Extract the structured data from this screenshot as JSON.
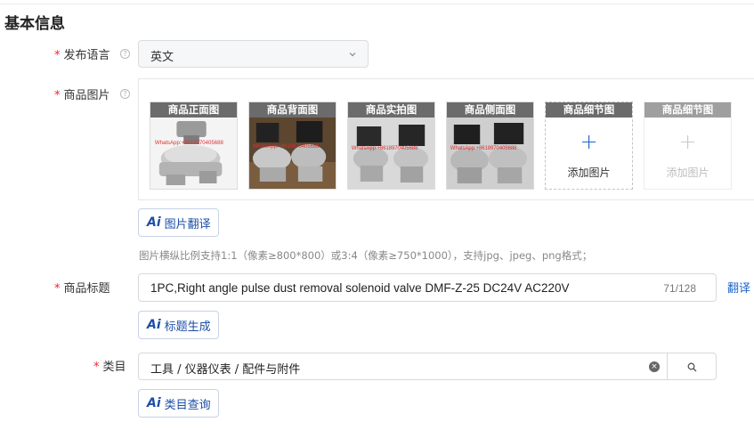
{
  "section": {
    "title": "基本信息"
  },
  "language": {
    "label": "发布语言",
    "required_mark": "*",
    "help": "?",
    "value": "英文"
  },
  "images": {
    "label": "商品图片",
    "required_mark": "*",
    "help": "?",
    "slots": [
      {
        "caption": "商品正面图",
        "watermark": "WhatsApp:+8618970405688"
      },
      {
        "caption": "商品背面图",
        "watermark": "WhatsApp:+8618970405688"
      },
      {
        "caption": "商品实拍图",
        "watermark": "WhatsApp:+8618970405688"
      },
      {
        "caption": "商品侧面图",
        "watermark": "WhatsApp:+8618970405688"
      }
    ],
    "add_slots": [
      {
        "caption": "商品细节图",
        "plus": "+",
        "add_label": "添加图片",
        "state": "enabled"
      },
      {
        "caption": "商品细节图",
        "plus": "+",
        "add_label": "添加图片",
        "state": "disabled"
      }
    ],
    "ai_translate": {
      "mark": "Ai",
      "label": "图片翻译"
    },
    "hint": "图片横纵比例支持1:1（像素≥800*800）或3:4（像素≥750*1000），支持jpg、jpeg、png格式；"
  },
  "product_title": {
    "label": "商品标题",
    "required_mark": "*",
    "value": "1PC,Right angle pulse dust removal solenoid valve DMF-Z-25 DC24V AC220V",
    "count": "71/128",
    "translate_link": "翻译",
    "ai_generate": {
      "mark": "Ai",
      "label": "标题生成"
    }
  },
  "category": {
    "label": "类目",
    "required_mark": "*",
    "value": "工具 / 仪器仪表 / 配件与附件",
    "clear": "×",
    "ai_query": {
      "mark": "Ai",
      "label": "类目查询"
    }
  },
  "colors": {
    "accent": "#1d64c8",
    "ai_blue": "#1d4fa5",
    "required": "#f5222d",
    "caption_bg": "#6b6b6b"
  },
  "icons": {
    "help": "question-circle-icon",
    "select": "chevron-down-icon",
    "clear": "close-circle-icon",
    "search": "search-icon",
    "add": "plus-icon"
  }
}
